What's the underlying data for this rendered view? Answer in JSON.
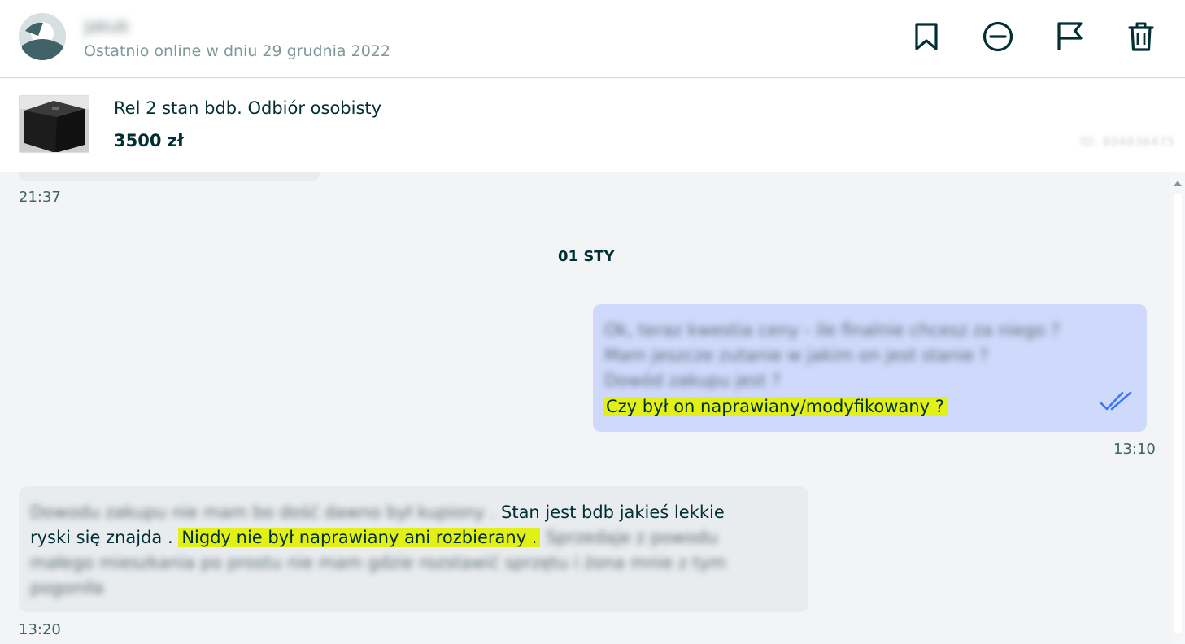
{
  "header": {
    "user_name": "Jakub",
    "last_online": "Ostatnio online w dniu 29 grudnia 2022",
    "actions": [
      {
        "icon": "bookmark-icon"
      },
      {
        "icon": "block-icon"
      },
      {
        "icon": "flag-icon"
      },
      {
        "icon": "trash-icon"
      }
    ]
  },
  "listing": {
    "title": "Rel 2 stan bdb. Odbiór osobisty",
    "price": "3500 zł",
    "id_label": "ID: 804836475"
  },
  "chat": {
    "prev_time": "21:37",
    "date_divider": "01 STY",
    "outgoing": {
      "lines_blurred": [
        "Ok, teraz kwestia ceny - ile finalnie chcesz za niego ?",
        "Mam jeszcze zutanie w jakim on jest stanie ?",
        "Dowód zakupu jest ?"
      ],
      "highlight": "Czy był on naprawiany/modyfikowany ?",
      "time": "13:10",
      "status": "read"
    },
    "incoming": {
      "line1_blurred": "Dowodu zakupu nie mam bo dość dawno był kupiony .",
      "line1_visible": "Stan jest bdb jakieś lekkie",
      "line2_start": "ryski się znajda .",
      "line2_highlight": "Nigdy nie był naprawiany ani rozbierany .",
      "line2_blurred": "Sprzedaje z powodu",
      "line3_blurred": "małego mieszkania po prostu nie mam gdzie rozstawić sprzętu i żona mnie z tym",
      "line4_blurred": "pogoniła",
      "time": "13:20"
    }
  },
  "colors": {
    "accent": "#002f34",
    "outgoing_bubble": "#cfd9fb",
    "incoming_bubble": "#e9ecee",
    "highlight": "#e3f016",
    "read_check": "#3a77ff"
  }
}
